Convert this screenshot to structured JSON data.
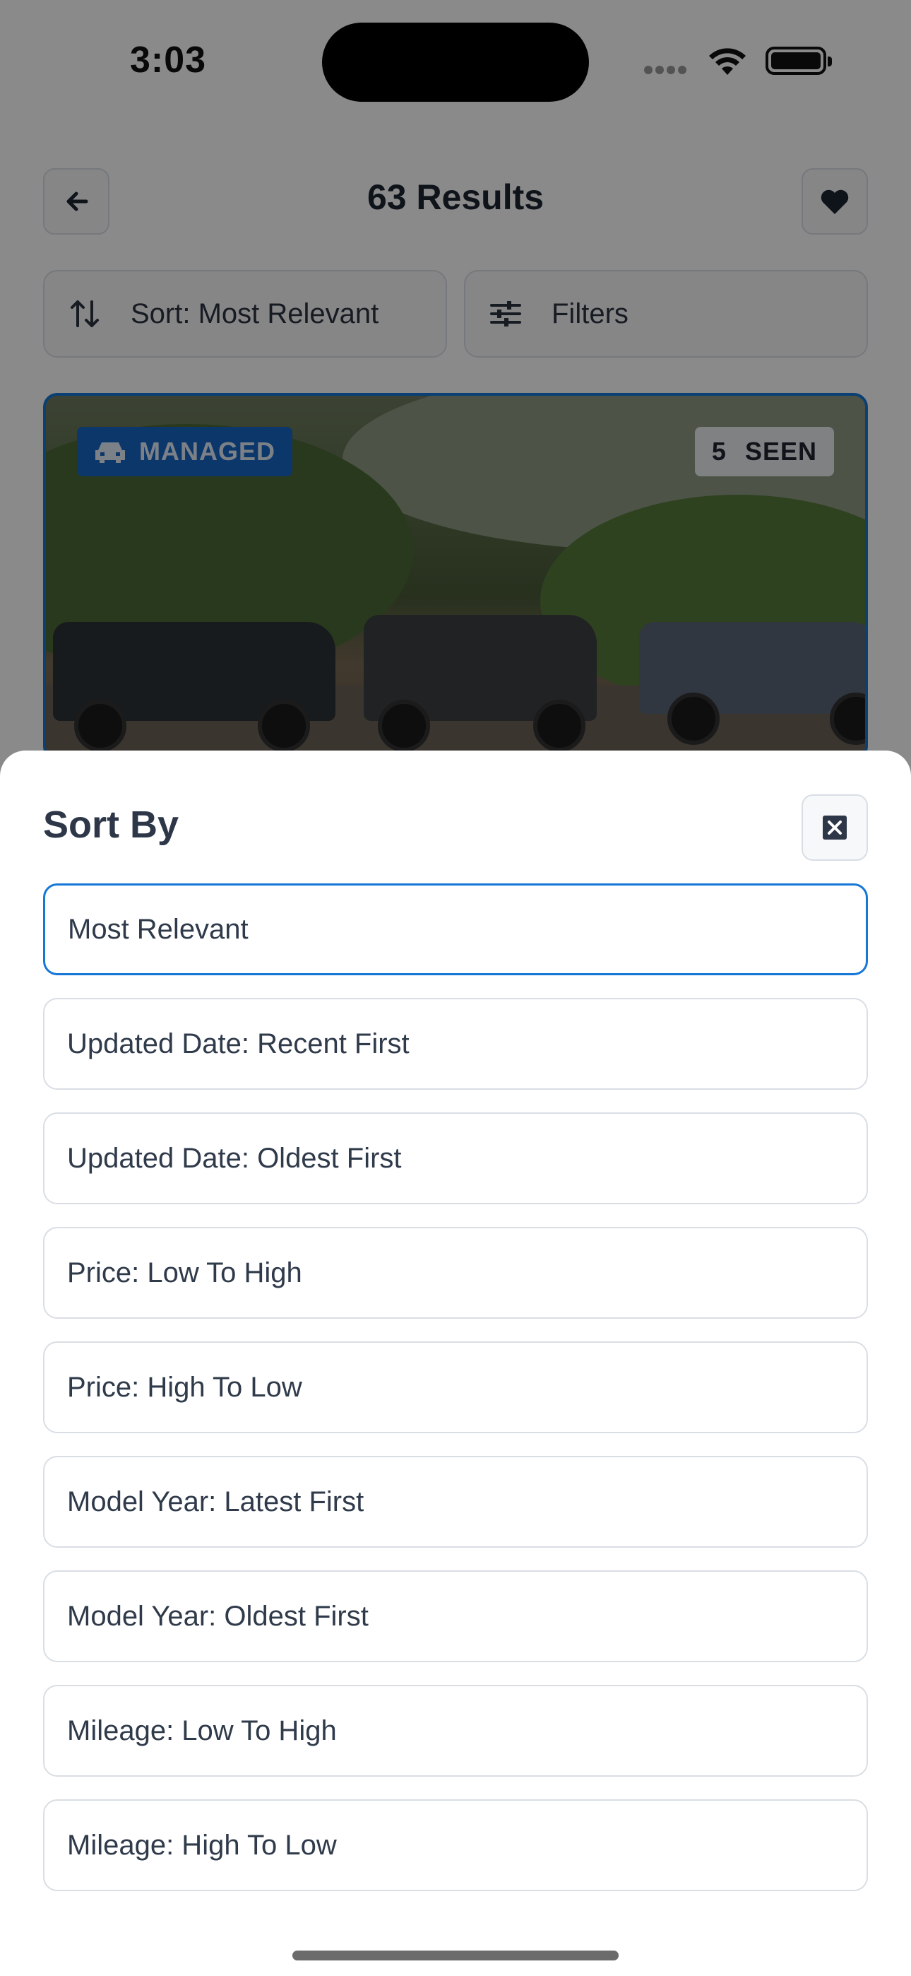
{
  "status_bar": {
    "time": "3:03"
  },
  "header": {
    "title": "63 Results",
    "back_icon": "arrow-left-icon",
    "favorite_icon": "heart-icon"
  },
  "toolbar": {
    "sort_label": "Sort: Most Relevant",
    "filters_label": "Filters"
  },
  "listing": {
    "managed_badge": "MANAGED",
    "seen_count": "5",
    "seen_label": "SEEN"
  },
  "sort_sheet": {
    "title": "Sort By",
    "selected": "Most Relevant",
    "options": [
      "Most Relevant",
      "Updated Date: Recent First",
      "Updated Date: Oldest First",
      "Price: Low To High",
      "Price: High To Low",
      "Model Year: Latest First",
      "Model Year: Oldest First",
      "Mileage: Low To High",
      "Mileage: High To Low"
    ]
  },
  "colors": {
    "accent": "#1677d6",
    "badge_blue": "#1666c6",
    "text_primary": "#2d3748"
  }
}
